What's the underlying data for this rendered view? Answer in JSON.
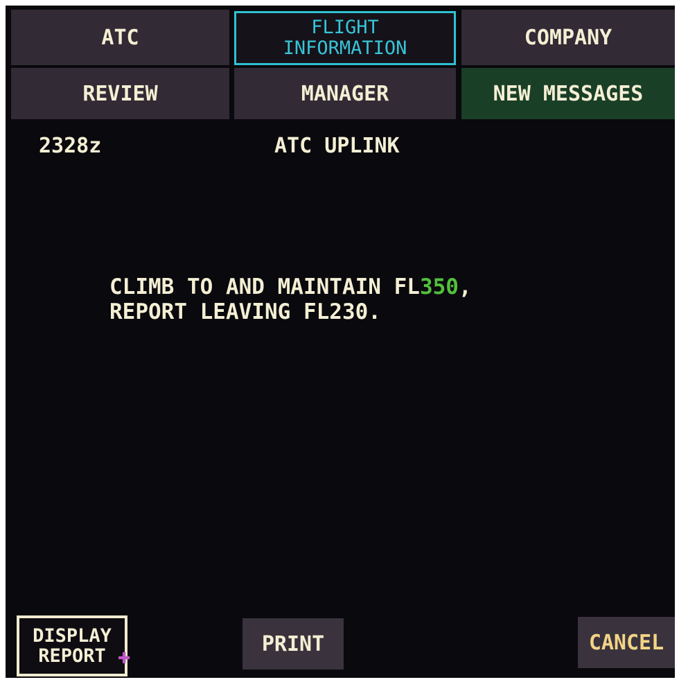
{
  "tabs": {
    "atc": "ATC",
    "flight_information": "FLIGHT\nINFORMATION",
    "company": "COMPANY",
    "review": "REVIEW",
    "manager": "MANAGER",
    "new_messages": "NEW MESSAGES"
  },
  "header": {
    "time": "2328z",
    "title": "ATC UPLINK"
  },
  "message": {
    "line1_prefix": "CLIMB TO AND MAINTAIN FL",
    "line1_highlight": "350",
    "line1_suffix": ",",
    "line2": "REPORT LEAVING FL230."
  },
  "buttons": {
    "display_report": "DISPLAY\nREPORT",
    "print": "PRINT",
    "cancel": "CANCEL"
  },
  "colors": {
    "selected_tab": "#2ec2d4",
    "highlight": "#52c03c",
    "new_messages_bg": "#1a3f27",
    "cancel_text": "#f2d486",
    "cursor": "#c058c8"
  },
  "icons": {
    "cursor": "cursor-crosshair-icon"
  }
}
